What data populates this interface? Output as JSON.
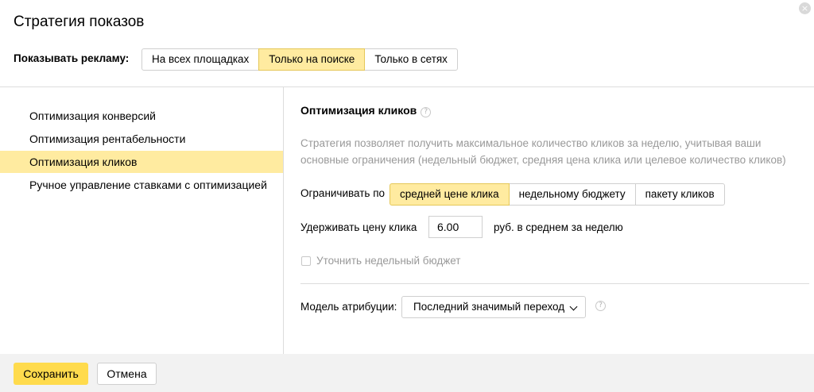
{
  "dialog": {
    "title": "Стратегия показов",
    "close_icon": "×"
  },
  "show_ads": {
    "label": "Показывать рекламу:",
    "options": [
      {
        "label": "На всех площадках",
        "active": false
      },
      {
        "label": "Только на поиске",
        "active": true
      },
      {
        "label": "Только в сетях",
        "active": false
      }
    ]
  },
  "strategies": [
    {
      "label": "Оптимизация конверсий",
      "active": false
    },
    {
      "label": "Оптимизация рентабельности",
      "active": false
    },
    {
      "label": "Оптимизация кликов",
      "active": true
    },
    {
      "label": "Ручное управление ставками с оптимизацией",
      "active": false
    }
  ],
  "detail": {
    "title": "Оптимизация кликов",
    "help_icon": "?",
    "description_line1": "Стратегия позволяет получить максимальное количество кликов за неделю, учитывая ваши",
    "description_line2": "основные ограничения (недельный бюджет, средняя цена клика или целевое количество кликов)",
    "limit_label": "Ограничивать по",
    "limit_options": [
      {
        "label": "средней цене клика",
        "active": true
      },
      {
        "label": "недельному бюджету",
        "active": false
      },
      {
        "label": "пакету кликов",
        "active": false
      }
    ],
    "hold_price_label": "Удерживать цену клика",
    "hold_price_value": "6.00",
    "hold_price_suffix": "руб. в среднем за неделю",
    "refine_budget_label": "Уточнить недельный бюджет",
    "refine_budget_checked": false,
    "attribution_label": "Модель атрибуции:",
    "attribution_value": "Последний значимый переход"
  },
  "footer": {
    "save_label": "Сохранить",
    "cancel_label": "Отмена"
  },
  "colors": {
    "accent_yellow": "#ffdb4d",
    "active_segment": "#ffeba0",
    "footer_bg": "#f2f2f2"
  }
}
